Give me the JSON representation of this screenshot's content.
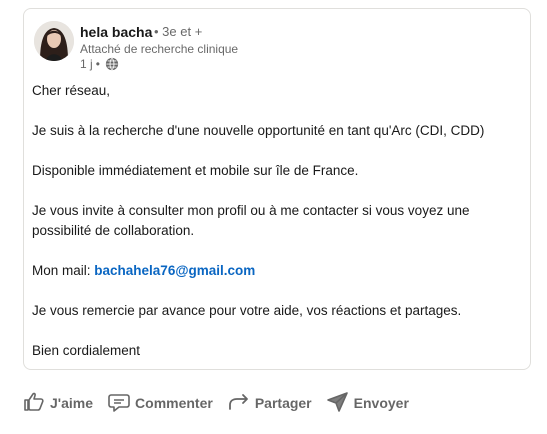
{
  "post": {
    "author": {
      "name": "hela bacha",
      "degree": "• 3e et +",
      "headline": "Attaché de recherche clinique",
      "time": "1 j",
      "visibility_icon": "globe-icon"
    },
    "body": {
      "greeting": "Cher réseau,",
      "p1": "Je suis à la recherche d'une nouvelle opportunité en tant qu'Arc (CDI, CDD)",
      "p2": "Disponible immédiatement et mobile sur île de France.",
      "p3": "Je vous invite à consulter mon profil ou à me contacter si vous voyez une possibilité de collaboration.",
      "mail_label": "Mon mail:",
      "mail_value": "bachahela76@gmail.com",
      "p4": "Je vous remercie par avance pour votre aide, vos réactions et partages.",
      "closing": "Bien cordialement"
    }
  },
  "actions": {
    "like": {
      "label": "J'aime",
      "icon": "thumbs-up-icon"
    },
    "comment": {
      "label": "Commenter",
      "icon": "comment-icon"
    },
    "share": {
      "label": "Partager",
      "icon": "share-arrow-icon"
    },
    "send": {
      "label": "Envoyer",
      "icon": "send-icon"
    }
  },
  "colors": {
    "link": "#0a66c2",
    "muted": "#666666",
    "border": "#e0dfdc"
  }
}
